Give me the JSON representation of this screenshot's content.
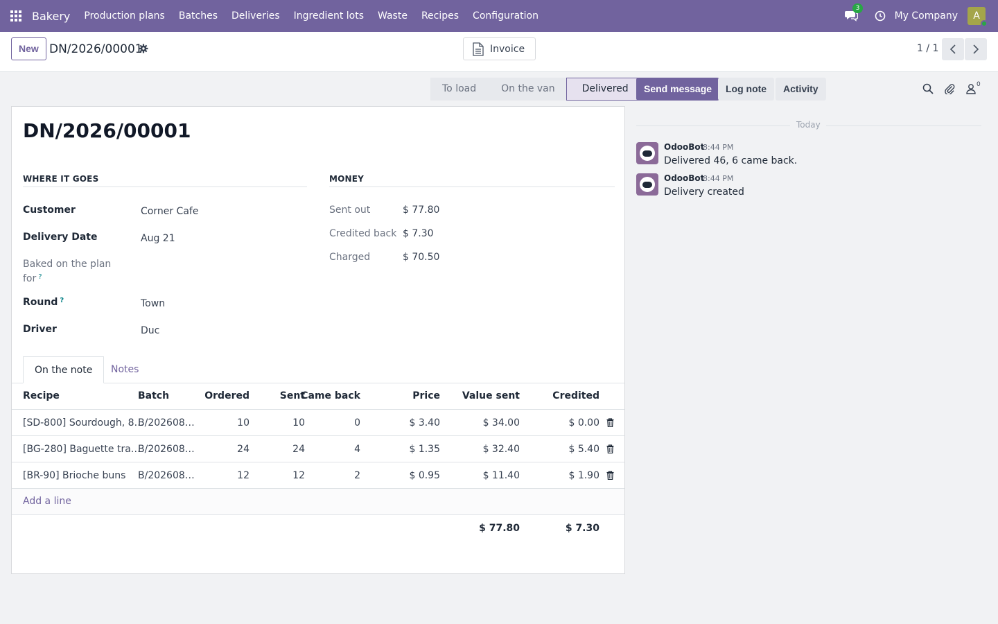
{
  "navbar": {
    "app_name": "Bakery",
    "menu": [
      "Production plans",
      "Batches",
      "Deliveries",
      "Ingredient lots",
      "Waste",
      "Recipes",
      "Configuration"
    ],
    "messages_count": "3",
    "company": "My Company",
    "avatar_initial": "A",
    "colors": {
      "bar": "#71639e",
      "online": "#28a745"
    }
  },
  "control": {
    "new_label": "New",
    "breadcrumb": "DN/2026/00001",
    "invoice_label": "Invoice",
    "pager": "1 / 1"
  },
  "statusbar": {
    "stages": [
      "To load",
      "On the van",
      "Delivered"
    ],
    "active": "Delivered"
  },
  "form": {
    "title": "DN/2026/00001",
    "group_left": "WHERE IT GOES",
    "group_right": "MONEY",
    "fields": {
      "customer_label": "Customer",
      "customer": "Corner Cafe",
      "date_label": "Delivery Date",
      "date": "Aug 21",
      "plan_label_1": "Baked on the plan",
      "plan_label_2": "for",
      "round_label": "Round",
      "round": "Town",
      "driver_label": "Driver",
      "driver": "Duc",
      "help_mark": "?"
    },
    "money": {
      "sent_label": "Sent out",
      "sent": "$ 77.80",
      "credited_label": "Credited back",
      "credited": "$ 7.30",
      "charged_label": "Charged",
      "charged": "$ 70.50"
    },
    "tabs": [
      "On the note",
      "Notes"
    ],
    "table": {
      "headers": [
        "Recipe",
        "Batch",
        "Ordered",
        "Sent",
        "Came back",
        "Price",
        "Value sent",
        "Credited"
      ],
      "rows": [
        [
          "[SD-800] Sourdough, 8…",
          "B/202608…",
          "10",
          "10",
          "0",
          "$ 3.40",
          "$ 34.00",
          "$ 0.00"
        ],
        [
          "[BG-280] Baguette tra…",
          "B/202608…",
          "24",
          "24",
          "4",
          "$ 1.35",
          "$ 32.40",
          "$ 5.40"
        ],
        [
          "[BR-90] Brioche buns",
          "B/202608…",
          "12",
          "12",
          "2",
          "$ 0.95",
          "$ 11.40",
          "$ 1.90"
        ]
      ],
      "add_line": "Add a line",
      "total_value_sent": "$ 77.80",
      "total_credited": "$ 7.30"
    }
  },
  "chatter": {
    "send_message": "Send message",
    "log_note": "Log note",
    "activity": "Activity",
    "followers": "0",
    "today": "Today",
    "messages": [
      {
        "author": "OdooBot",
        "time": "8:44 PM",
        "body": "Delivered 46, 6 came back."
      },
      {
        "author": "OdooBot",
        "time": "8:44 PM",
        "body": "Delivery created"
      }
    ]
  }
}
